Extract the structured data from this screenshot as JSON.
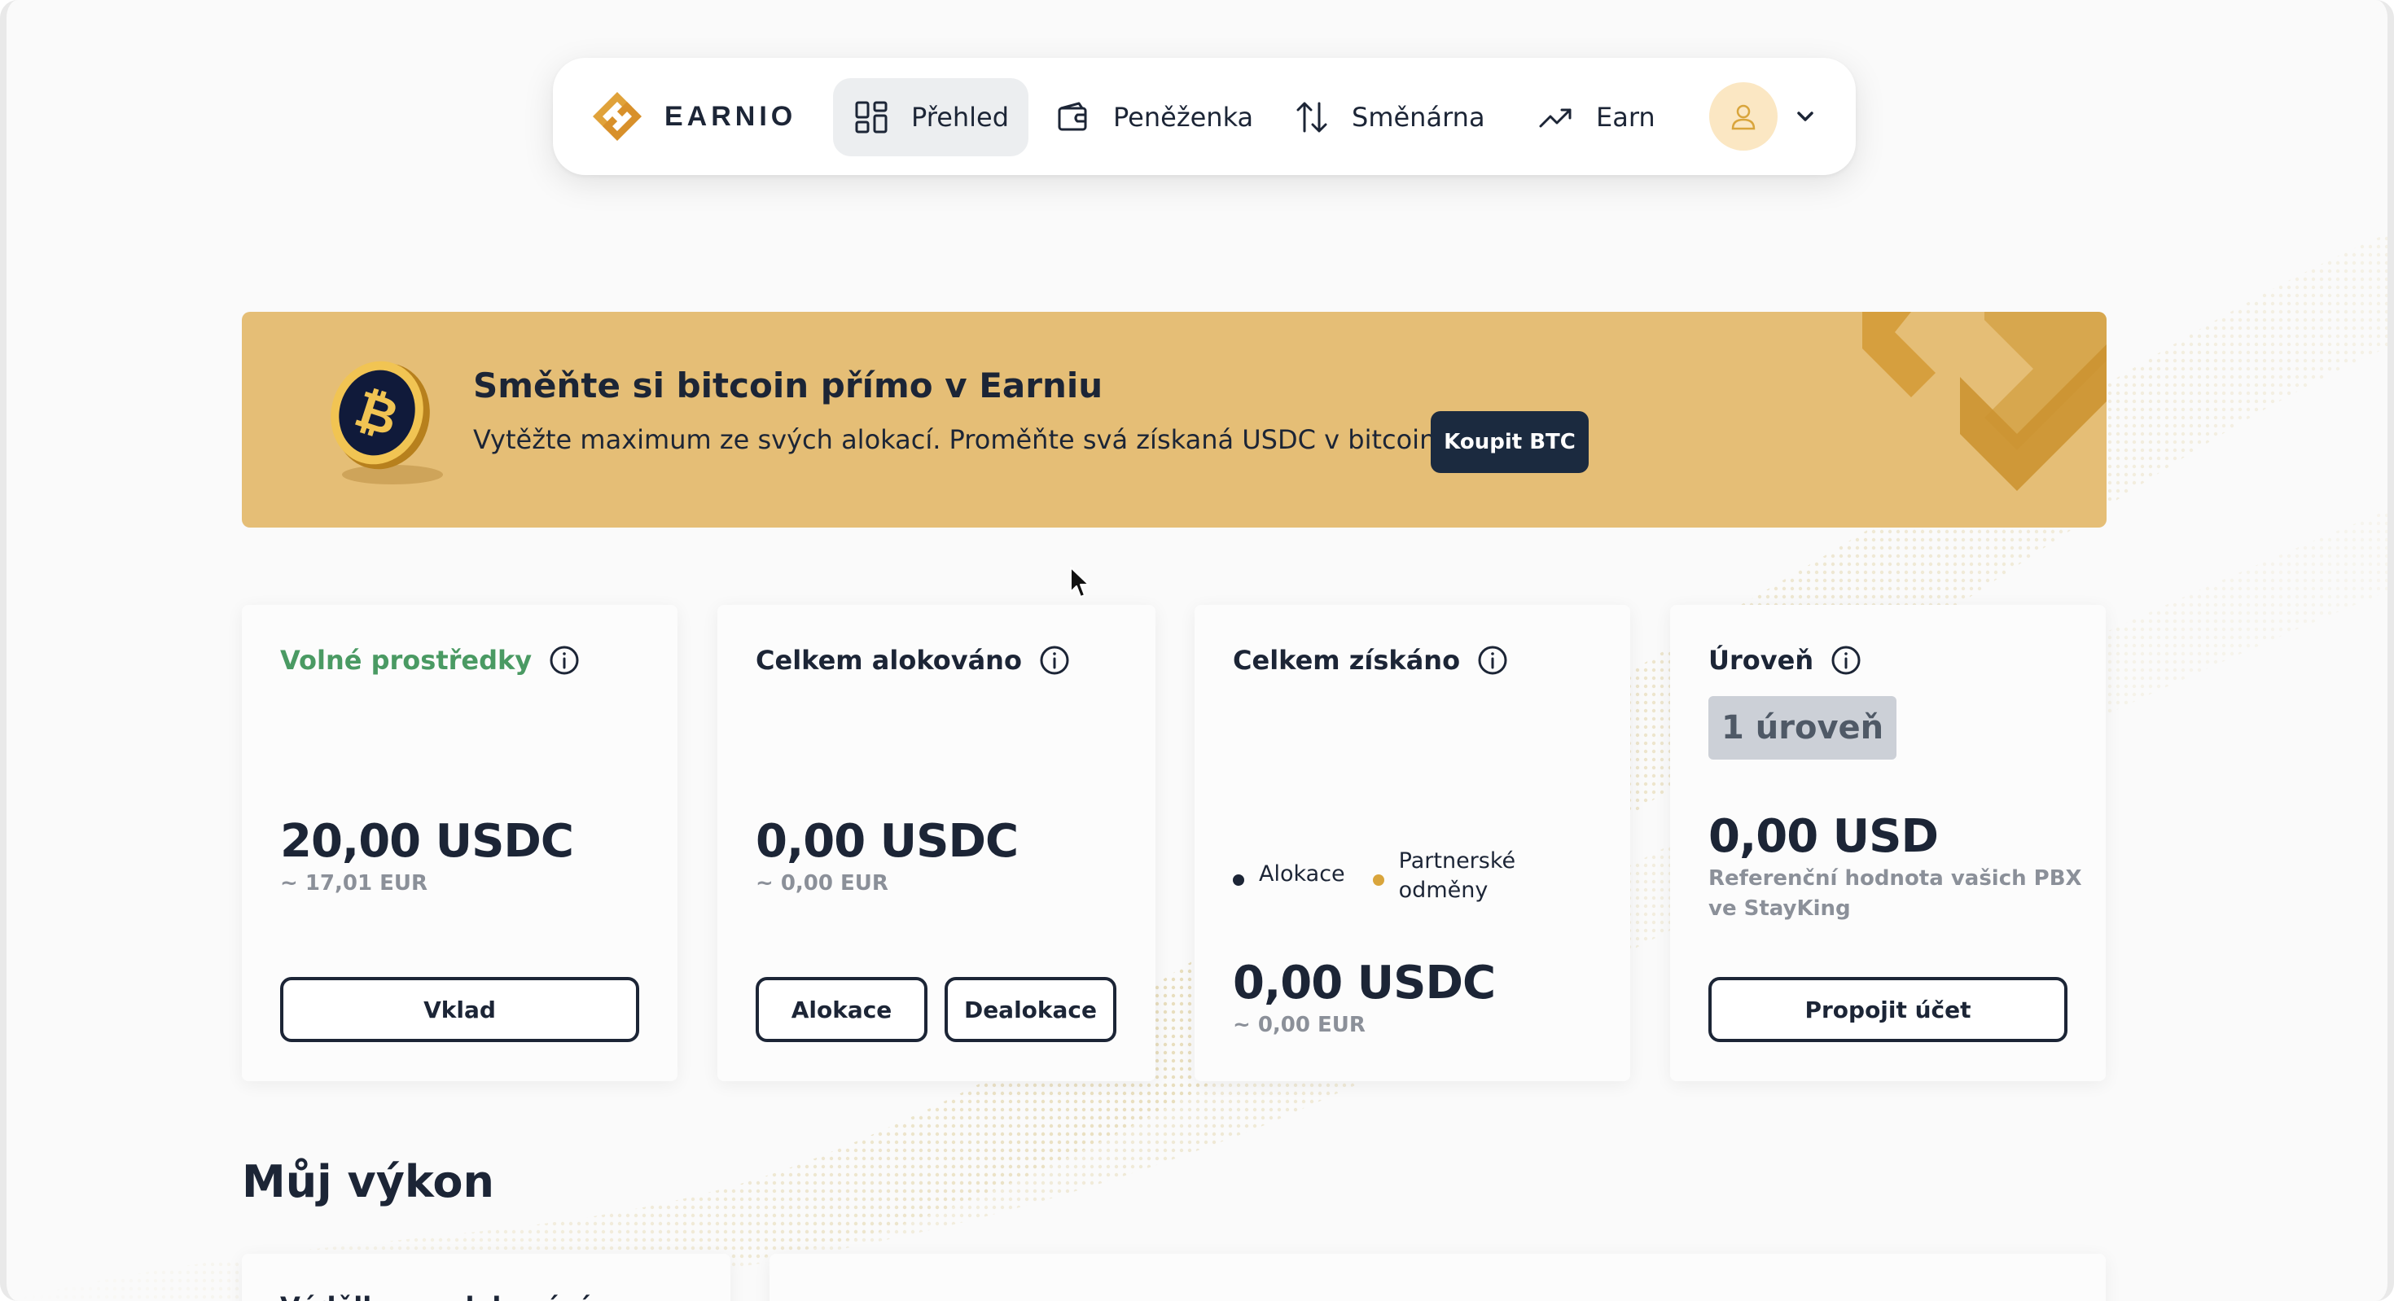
{
  "brand": {
    "name": "EARNIO",
    "accent": "#d9a53c"
  },
  "nav": {
    "items": [
      {
        "label": "Přehled",
        "icon": "dashboard-icon",
        "active": true
      },
      {
        "label": "Peněženka",
        "icon": "wallet-icon",
        "active": false
      },
      {
        "label": "Směnárna",
        "icon": "exchange-icon",
        "active": false
      },
      {
        "label": "Earn",
        "icon": "trending-up-icon",
        "active": false
      }
    ],
    "user_icon": "user-icon"
  },
  "banner": {
    "title": "Směňte si bitcoin přímo v Earniu",
    "text": "Vytěžte maximum ze svých alokací. Proměňte svá získaná USDC v bitcoin.",
    "button": "Koupit BTC",
    "background": "#e5be76"
  },
  "cards": {
    "free": {
      "title": "Volné prostředky",
      "amount": "20,00 USDC",
      "sub": "~ 17,01 EUR",
      "button": "Vklad"
    },
    "allocated": {
      "title": "Celkem alokováno",
      "amount": "0,00 USDC",
      "sub": "~ 0,00 EUR",
      "button_allocate": "Alokace",
      "button_deallocate": "Dealokace"
    },
    "earned": {
      "title": "Celkem získáno",
      "legend_allocation": "Alokace",
      "legend_partner_line1": "Partnerské",
      "legend_partner_line2": "odměny",
      "amount": "0,00 USDC",
      "sub": "~ 0,00 EUR"
    },
    "level": {
      "title": "Úroveň",
      "badge": "1 úroveň",
      "amount": "0,00 USD",
      "ref_text": "Referenční hodnota vašich PBX ve StayKing",
      "button": "Propojit účet"
    }
  },
  "performance": {
    "title": "Můj výkon",
    "card_title": "Výdělky za alokování"
  }
}
